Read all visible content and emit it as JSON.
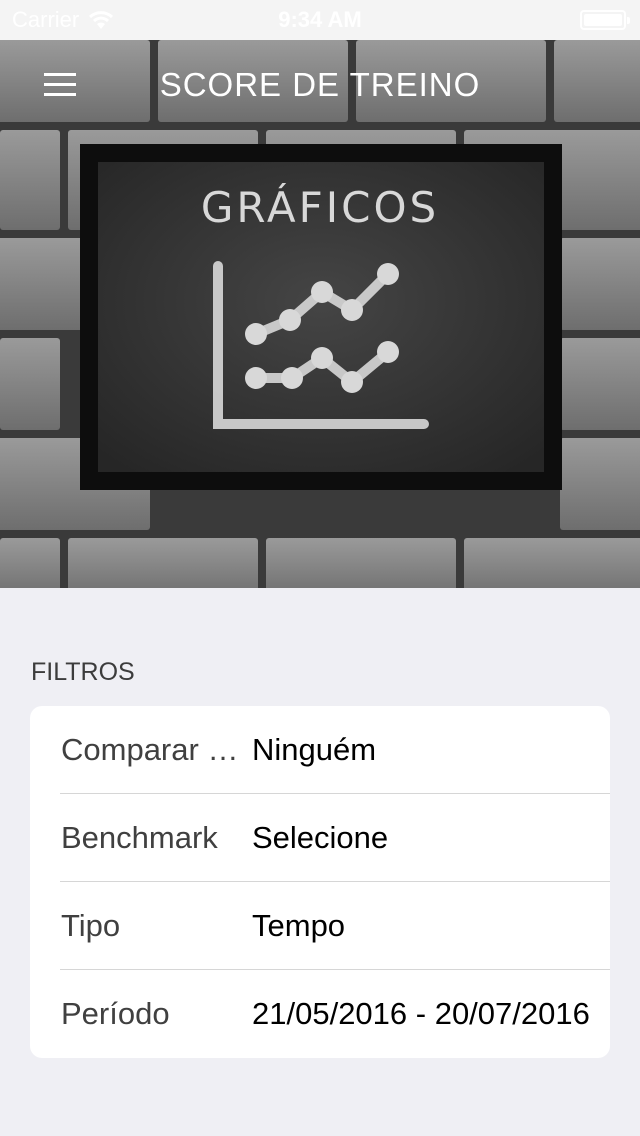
{
  "status_bar": {
    "carrier": "Carrier",
    "time": "9:34 AM"
  },
  "nav": {
    "title": "SCORE DE TREINO",
    "menu_icon": "hamburger-icon"
  },
  "hero": {
    "board_text": "GRÁFICOS",
    "illustration": "chalkboard-line-chart"
  },
  "filters": {
    "header": "FILTROS",
    "rows": [
      {
        "label": "Comparar com",
        "value": "Ninguém"
      },
      {
        "label": "Benchmark",
        "value": "Selecione"
      },
      {
        "label": "Tipo",
        "value": "Tempo"
      },
      {
        "label": "Período",
        "value": "21/05/2016 - 20/07/2016"
      }
    ]
  },
  "colors": {
    "background": "#efeff4",
    "card": "#ffffff",
    "chalk": "#d8d8d8",
    "board": "#2c2c2c"
  }
}
